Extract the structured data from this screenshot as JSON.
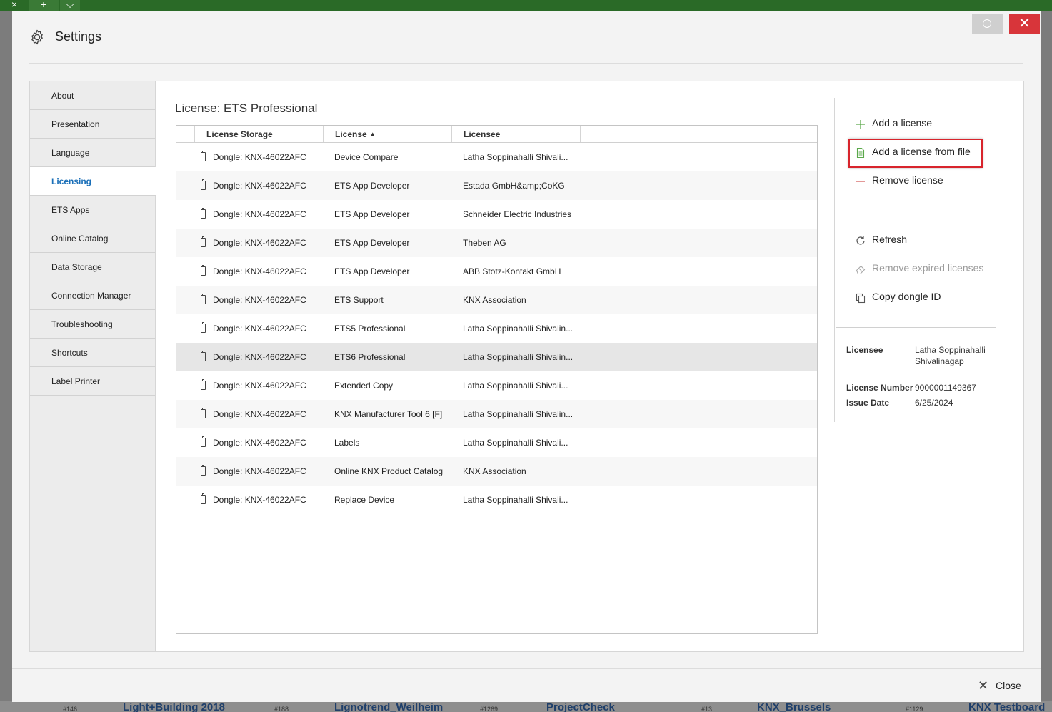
{
  "background": {
    "tab_close": "×",
    "tab_add": "+",
    "tab_menu": "⌵",
    "bottom_items": [
      {
        "num": "#146",
        "name": "Light+Building 2018"
      },
      {
        "num": "#188",
        "name": "Lignotrend_Weilheim"
      },
      {
        "num": "#1269",
        "name": "ProjectCheck"
      },
      {
        "num": "#13",
        "name": "KNX_Brussels"
      },
      {
        "num": "#1129",
        "name": "KNX Testboard"
      }
    ]
  },
  "dialog": {
    "title": "Settings",
    "title_icon": "gear-icon",
    "close_glyph": "✕"
  },
  "nav": {
    "items": [
      {
        "label": "About"
      },
      {
        "label": "Presentation"
      },
      {
        "label": "Language"
      },
      {
        "label": "Licensing"
      },
      {
        "label": "ETS Apps"
      },
      {
        "label": "Online Catalog"
      },
      {
        "label": "Data Storage"
      },
      {
        "label": "Connection Manager"
      },
      {
        "label": "Troubleshooting"
      },
      {
        "label": "Shortcuts"
      },
      {
        "label": "Label Printer"
      }
    ],
    "active": "Licensing"
  },
  "main": {
    "title": "License: ETS Professional",
    "columns": [
      "License Storage",
      "License",
      "Licensee"
    ],
    "sort_indicator": "▲",
    "rows": [
      {
        "storage": "Dongle: KNX-46022AFC",
        "license": "Device Compare",
        "licensee": "Latha Soppinahalli Shivali..."
      },
      {
        "storage": "Dongle: KNX-46022AFC",
        "license": "ETS App Developer",
        "licensee": "Estada GmbH&amp;CoKG"
      },
      {
        "storage": "Dongle: KNX-46022AFC",
        "license": "ETS App Developer",
        "licensee": "Schneider Electric Industries"
      },
      {
        "storage": "Dongle: KNX-46022AFC",
        "license": "ETS App Developer",
        "licensee": "Theben AG"
      },
      {
        "storage": "Dongle: KNX-46022AFC",
        "license": "ETS App Developer",
        "licensee": "ABB Stotz-Kontakt GmbH"
      },
      {
        "storage": "Dongle: KNX-46022AFC",
        "license": "ETS Support",
        "licensee": "KNX Association"
      },
      {
        "storage": "Dongle: KNX-46022AFC",
        "license": "ETS5 Professional",
        "licensee": "Latha Soppinahalli Shivalin..."
      },
      {
        "storage": "Dongle: KNX-46022AFC",
        "license": "ETS6 Professional",
        "licensee": "Latha Soppinahalli Shivalin..."
      },
      {
        "storage": "Dongle: KNX-46022AFC",
        "license": "Extended Copy",
        "licensee": "Latha Soppinahalli Shivali..."
      },
      {
        "storage": "Dongle: KNX-46022AFC",
        "license": "KNX Manufacturer Tool 6 [F]",
        "licensee": "Latha Soppinahalli Shivalin..."
      },
      {
        "storage": "Dongle: KNX-46022AFC",
        "license": "Labels",
        "licensee": "Latha Soppinahalli Shivali..."
      },
      {
        "storage": "Dongle: KNX-46022AFC",
        "license": "Online KNX Product Catalog",
        "licensee": "KNX Association"
      },
      {
        "storage": "Dongle: KNX-46022AFC",
        "license": "Replace Device",
        "licensee": "Latha Soppinahalli Shivali..."
      }
    ],
    "selected_row": 7
  },
  "actions": {
    "add_license": "Add a license",
    "add_license_from_file": "Add a license from file",
    "remove_license": "Remove license",
    "refresh": "Refresh",
    "remove_expired": "Remove expired licenses",
    "copy_dongle_id": "Copy dongle ID"
  },
  "details": {
    "licensee_label": "Licensee",
    "licensee_value": "Latha Soppinahalli Shivalinagap",
    "license_number_label": "License Number",
    "license_number_value": "9000001149367",
    "issue_date_label": "Issue Date",
    "issue_date_value": "6/25/2024"
  },
  "footer": {
    "close_label": "Close"
  },
  "colors": {
    "accent": "#1a6fb8",
    "highlight_box": "#d8242c",
    "window_close": "#d8353a",
    "app_topbar": "#2a6a27"
  }
}
